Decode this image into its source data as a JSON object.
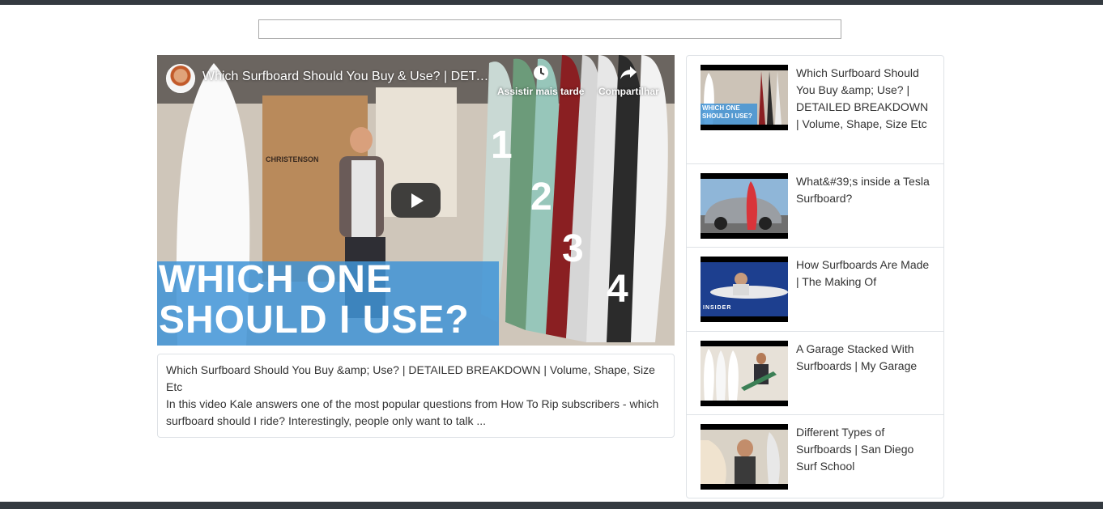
{
  "search": {
    "value": "",
    "placeholder": ""
  },
  "player": {
    "title": "Which Surfboard Should You Buy & Use? | DETAILED BREAKDOWN | Volume, Shape, Size Etc",
    "watch_later_label": "Assistir mais tarde",
    "share_label": "Compartilhar",
    "overlay_line1": "WHICH ONE",
    "overlay_line2": "SHOULD I USE?",
    "numbers": [
      "1",
      "2",
      "3",
      "4"
    ],
    "sign_text": "CHRISTENSON"
  },
  "description": {
    "title": "Which Surfboard Should You Buy &amp; Use? | DETAILED BREAKDOWN | Volume, Shape, Size Etc",
    "text": "In this video Kale answers one of the most popular questions from How To Rip subscribers - which surfboard should I ride? Interestingly, people only want to talk ..."
  },
  "related": [
    {
      "title": "Which Surfboard Should You Buy &amp; Use? | DETAILED BREAKDOWN | Volume, Shape, Size Etc",
      "thumb_text": "WHICH ONE SHOULD I USE?"
    },
    {
      "title": "What&#39;s inside a Tesla Surfboard?"
    },
    {
      "title": "How Surfboards Are Made | The Making Of",
      "thumb_text": "INSIDER"
    },
    {
      "title": "A Garage Stacked With Surfboards | My Garage"
    },
    {
      "title": "Different Types of Surfboards | San Diego Surf School"
    }
  ]
}
